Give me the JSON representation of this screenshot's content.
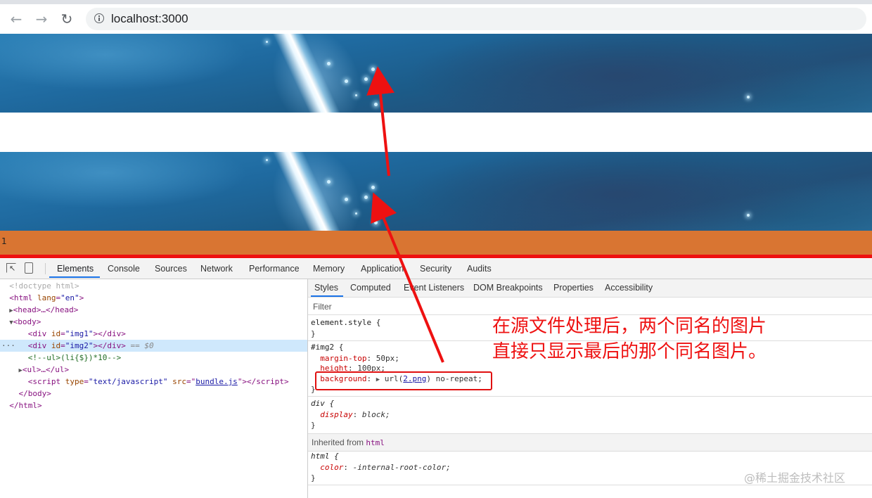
{
  "browser": {
    "back_icon": "←",
    "forward_icon": "→",
    "reload_icon": "↻",
    "url": "localhost:3000"
  },
  "page": {
    "orange_text": "1"
  },
  "devtools": {
    "tabs": [
      "Elements",
      "Console",
      "Sources",
      "Network",
      "Performance",
      "Memory",
      "Application",
      "Security",
      "Audits"
    ],
    "elements": {
      "doctype": "<!doctype html>",
      "html_tag": "html",
      "lang_attr": "lang",
      "lang_val": "\"en\"",
      "head": "<head>…</head>",
      "body_open": "<body>",
      "div1_id": "\"img1\"",
      "div2_id": "\"img2\"",
      "selected_marker": "== $0",
      "comment": "<!--ul>(li{$})*10-->",
      "ul": "<ul>…</ul>",
      "script_type": "\"text/javascript\"",
      "script_src": "bundle.js",
      "body_close": "</body>",
      "html_close": "</html>"
    },
    "styles": {
      "subtabs": [
        "Styles",
        "Computed",
        "Event Listeners",
        "DOM Breakpoints",
        "Properties",
        "Accessibility"
      ],
      "filter_placeholder": "Filter",
      "element_style": "element.style {",
      "close_brace": "}",
      "img2_selector": "#img2 {",
      "margin_top": "margin-top",
      "margin_top_val": "50px;",
      "height": "height",
      "height_val": "100px;",
      "background": "background",
      "background_url": "2.png",
      "background_rest": ") no-repeat;",
      "div_selector": "div {",
      "display": "display",
      "display_val": "block;",
      "inherited_from": "Inherited from",
      "inherited_tag": "html",
      "html_selector": "html {",
      "color": "color",
      "color_val": "-internal-root-color;"
    }
  },
  "annotation": {
    "line1": "在源文件处理后，两个同名的图片",
    "line2": "直接只显示最后的那个同名图片。"
  },
  "watermark": "@稀土掘金技术社区",
  "colors": {
    "orange_bar": "#d97532",
    "red_annotation": "#ee1111",
    "devtools_accent": "#1a73e8"
  }
}
